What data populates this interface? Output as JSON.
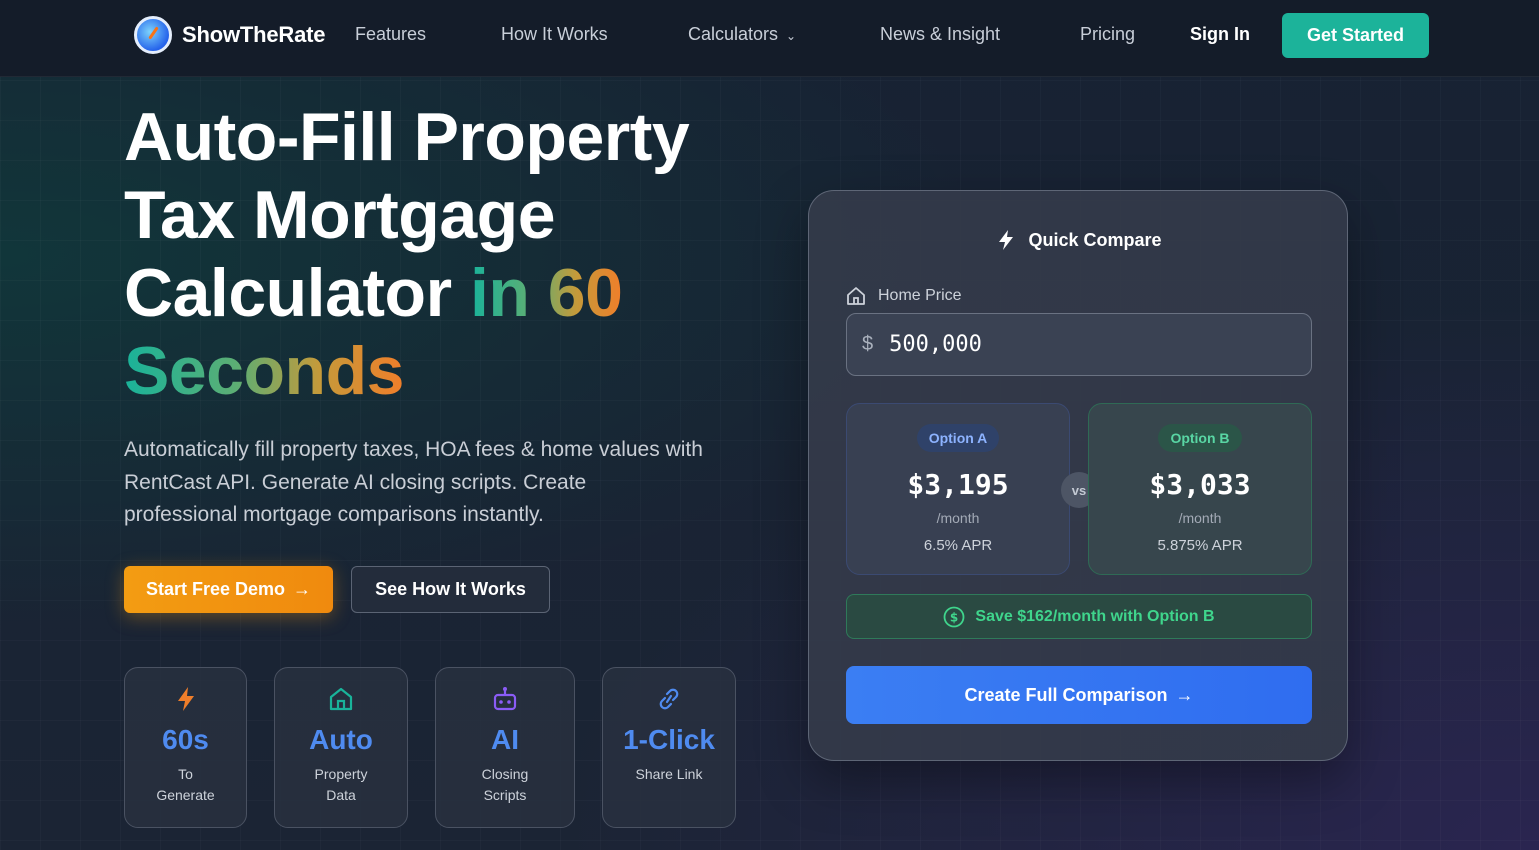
{
  "brand": {
    "name": "ShowTheRate",
    "logo_icon": "gauge-logo-icon"
  },
  "nav": {
    "links": [
      "Features",
      "How It Works",
      "Calculators",
      "News & Insight",
      "Pricing"
    ],
    "calculators_chevron": "⌄",
    "sign_in": "Sign In",
    "get_started": "Get Started"
  },
  "hero": {
    "title_line1": "Auto-Fill Property",
    "title_line2": "Tax Mortgage",
    "title_line3": "Calculator",
    "title_accent_a": "in 60",
    "title_accent_b": "Seconds",
    "subtitle": "Automatically fill property taxes, HOA fees & home values with RentCast API. Generate AI closing scripts. Create professional mortgage comparisons instantly.",
    "primary_cta": "Start Free Demo",
    "primary_cta_arrow": "→",
    "secondary_cta": "See How It Works"
  },
  "stats": [
    {
      "icon": "lightning-icon",
      "value": "60s",
      "label_1": "To",
      "label_2": "Generate"
    },
    {
      "icon": "home-icon",
      "value": "Auto",
      "label_1": "Property",
      "label_2": "Data"
    },
    {
      "icon": "robot-icon",
      "value": "AI",
      "label_1": "Closing",
      "label_2": "Scripts"
    },
    {
      "icon": "link-icon",
      "value": "1-Click",
      "label_1": "Share Link",
      "label_2": ""
    }
  ],
  "compare": {
    "title": "Quick Compare",
    "home_price_label": "Home Price",
    "currency": "$",
    "home_price_value": "500,000",
    "option_a": {
      "label": "Option A",
      "amount": "$3,195",
      "per": "/month",
      "apr": "6.5% APR"
    },
    "option_b": {
      "label": "Option B",
      "amount": "$3,033",
      "per": "/month",
      "apr": "5.875% APR"
    },
    "vs": "vs",
    "savings": "Save $162/month with Option B",
    "cta": "Create Full Comparison",
    "cta_arrow": "→"
  },
  "colors": {
    "accent_teal": "#1cb39a",
    "accent_orange": "#f39c12",
    "accent_blue": "#3b7ef3",
    "savings_green": "#3fd58c"
  }
}
